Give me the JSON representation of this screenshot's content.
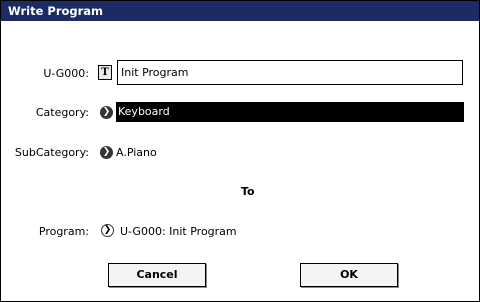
{
  "dialog": {
    "title": "Write Program",
    "name_label": "U-G000:",
    "name_icon": "T",
    "name_value": "Init Program",
    "category_label": "Category:",
    "category_value": "Keyboard",
    "subcategory_label": "SubCategory:",
    "subcategory_value": "A.Piano",
    "to_label": "To",
    "program_label": "Program:",
    "program_value": "U-G000: Init Program",
    "cancel_label": "Cancel",
    "ok_label": "OK"
  }
}
